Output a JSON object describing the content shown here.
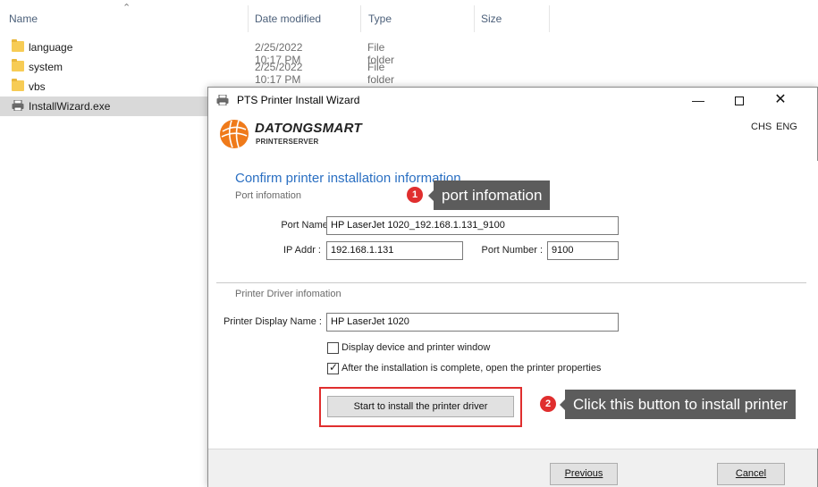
{
  "explorer": {
    "columns": {
      "name": "Name",
      "date_modified": "Date modified",
      "type": "Type",
      "size": "Size"
    },
    "files": [
      {
        "name": "language",
        "date": "2/25/2022 10:17 PM",
        "type": "File folder",
        "icon": "folder-icon"
      },
      {
        "name": "system",
        "date": "2/25/2022 10:17 PM",
        "type": "File folder",
        "icon": "folder-icon"
      },
      {
        "name": "vbs",
        "date": "",
        "type": "",
        "icon": "folder-icon"
      },
      {
        "name": "InstallWizard.exe",
        "date": "",
        "type": "",
        "icon": "printer-icon",
        "selected": true
      }
    ]
  },
  "wizard": {
    "title": "PTS Printer Install Wizard",
    "brand": "DATONGSMART",
    "brand_sub": "PRINTERSERVER",
    "lang_chs": "CHS",
    "lang_eng": "ENG",
    "heading": "Confirm printer installation information",
    "port_section": "Port infomation",
    "port_name_label": "Port Name :",
    "port_name_value": "HP LaserJet 1020_192.168.1.131_9100",
    "ip_label": "IP Addr :",
    "ip_value": "192.168.1.131",
    "port_number_label": "Port Number :",
    "port_number_value": "9100",
    "driver_section": "Printer Driver infomation",
    "display_name_label": "Printer Display Name :",
    "display_name_value": "HP LaserJet 1020",
    "checkbox_display_device": {
      "label": "Display device and printer window",
      "checked": false
    },
    "checkbox_open_properties": {
      "label": "After the installation is complete, open the printer properties",
      "checked": true
    },
    "install_button": "Start to install the printer driver",
    "previous_button": "Previous",
    "cancel_button": "Cancel"
  },
  "callouts": [
    {
      "number": "1",
      "text": "port infomation"
    },
    {
      "number": "2",
      "text": "Click this button to install printer"
    }
  ],
  "colors": {
    "accent": "#2a6fc2",
    "callout_red": "#e02e2e",
    "tooltip_bg": "#5c5c5c",
    "logo_orange": "#ef7a1a"
  }
}
